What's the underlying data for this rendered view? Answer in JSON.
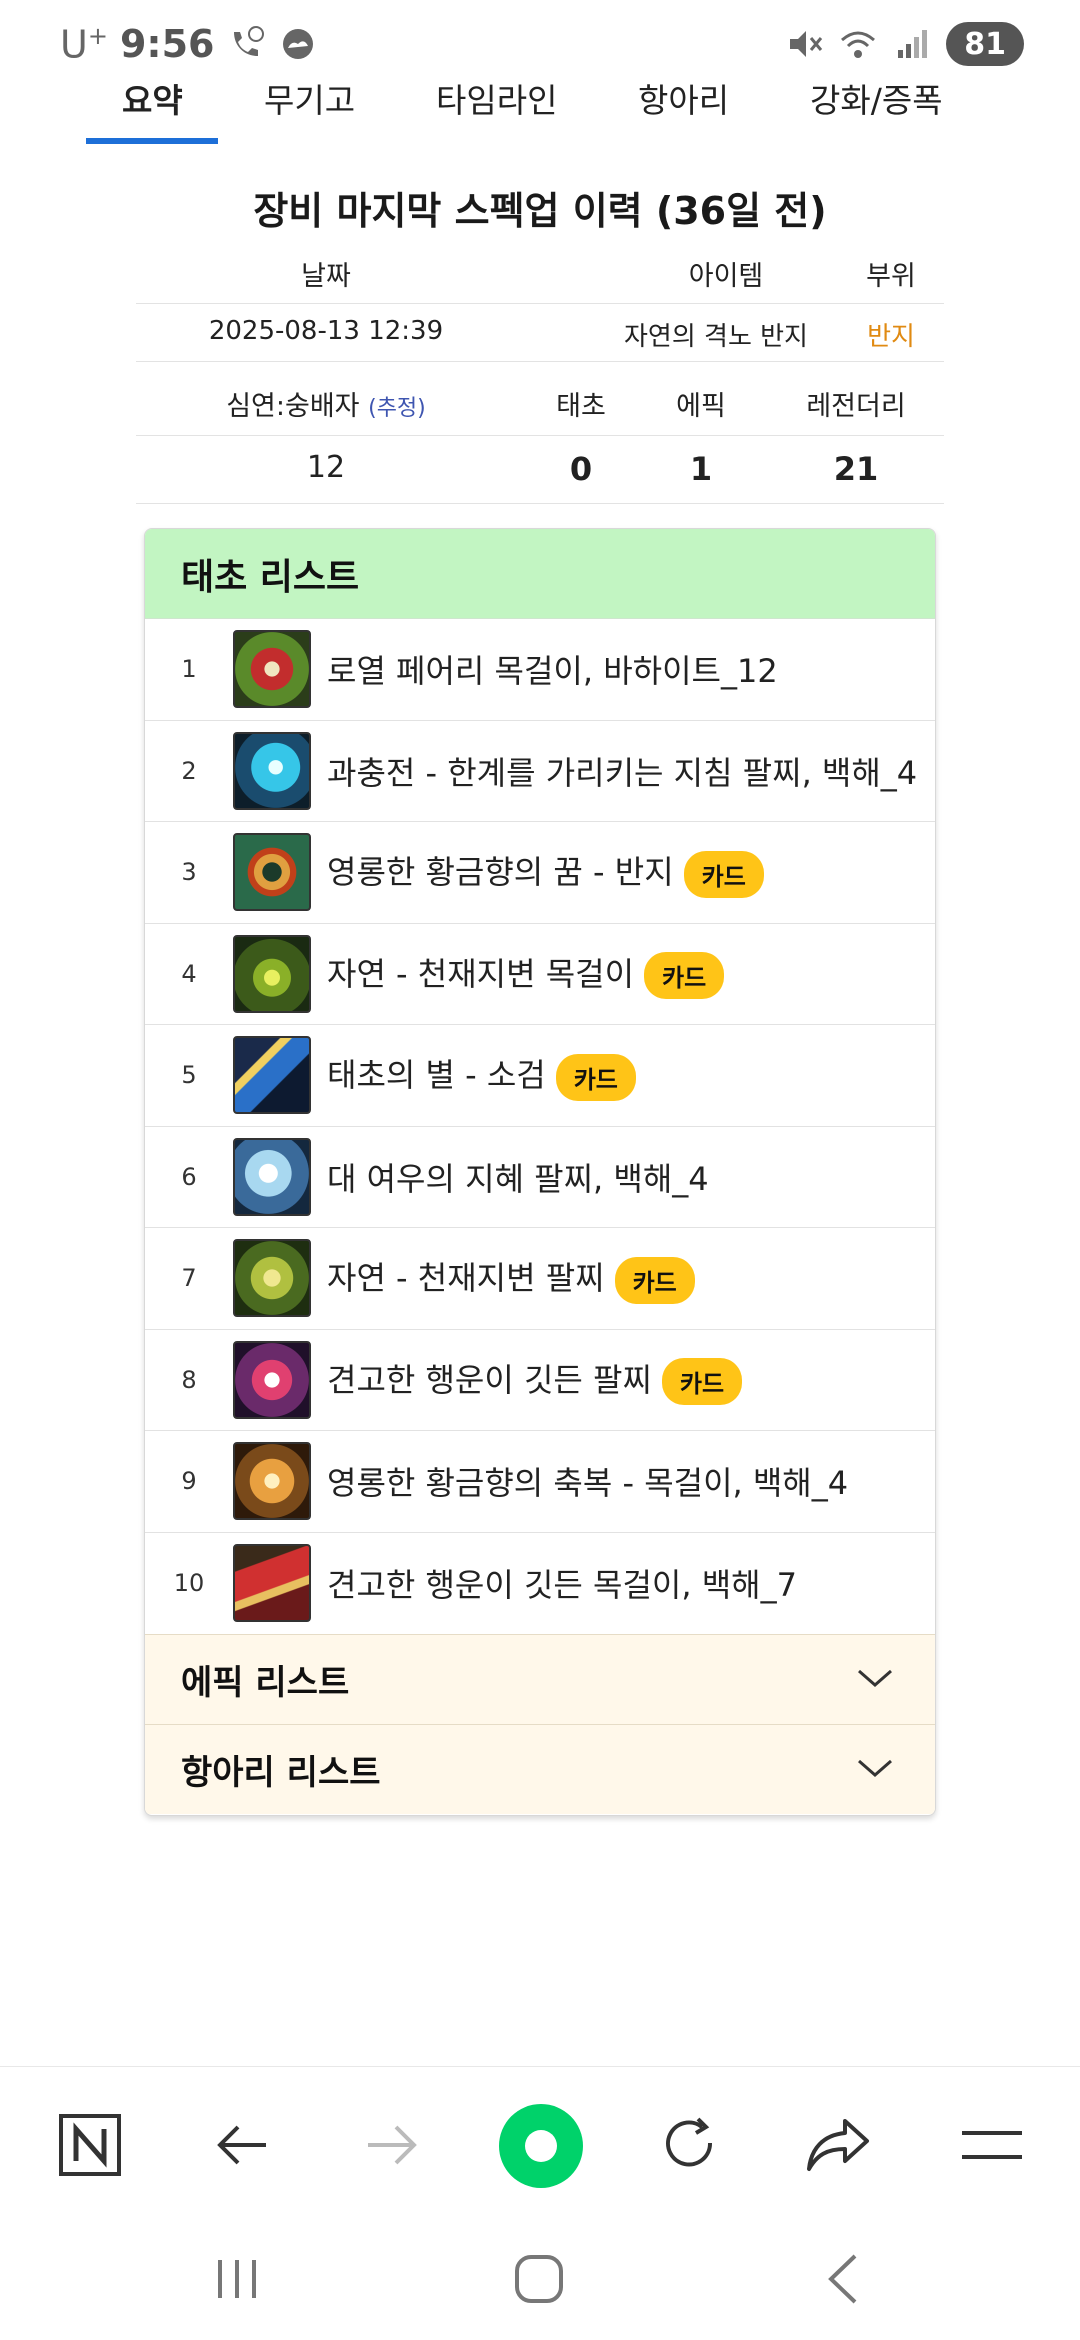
{
  "status": {
    "carrier": "U",
    "carrier_sup": "+",
    "time": "9:56",
    "battery": "81",
    "icons": [
      "phone-who-icon",
      "weather-icon",
      "mute-icon",
      "wifi-icon",
      "signal-icon"
    ]
  },
  "tabs": [
    {
      "label": "요약",
      "active": true
    },
    {
      "label": "무기고",
      "active": false
    },
    {
      "label": "타임라인",
      "active": false
    },
    {
      "label": "항아리",
      "active": false
    },
    {
      "label": "강화/증폭",
      "active": false
    }
  ],
  "summary": {
    "title": "장비 마지막 스펙업 이력 (36일 전)",
    "headers": {
      "date": "날짜",
      "item": "아이템",
      "slot": "부위"
    },
    "row": {
      "date": "2025-08-13 12:39",
      "item": "자연의 격노 반지",
      "slot": "반지"
    },
    "stat_headers": {
      "depth": "심연:숭배자",
      "estimate": "(추정)",
      "primeval": "태초",
      "epic": "에픽",
      "legendary": "레전더리"
    },
    "stat_values": {
      "depth": "12",
      "primeval": "0",
      "epic": "1",
      "legendary": "21"
    }
  },
  "primeval_list": {
    "title": "태초 리스트",
    "badge_label": "카드",
    "items": [
      {
        "index": "1",
        "name": "로열 페어리 목걸이, 바하이트_12",
        "card": false,
        "icon": "flower-necklace-icon"
      },
      {
        "index": "2",
        "name": "과충전 - 한계를 가리키는 지침 팔찌, 백해_4",
        "card": false,
        "icon": "charged-bracelet-icon"
      },
      {
        "index": "3",
        "name": "영롱한 황금향의 꿈 - 반지",
        "card": true,
        "icon": "golden-ring-icon"
      },
      {
        "index": "4",
        "name": "자연 - 천재지변 목걸이",
        "card": true,
        "icon": "nature-necklace-icon"
      },
      {
        "index": "5",
        "name": "태초의 별 - 소검",
        "card": true,
        "icon": "star-sword-icon"
      },
      {
        "index": "6",
        "name": "대 여우의 지혜 팔찌, 백해_4",
        "card": false,
        "icon": "fox-bracelet-icon"
      },
      {
        "index": "7",
        "name": "자연 - 천재지변 팔찌",
        "card": true,
        "icon": "nature-bracelet-icon"
      },
      {
        "index": "8",
        "name": "견고한 행운이 깃든 팔찌",
        "card": true,
        "icon": "luck-bracelet-icon"
      },
      {
        "index": "9",
        "name": "영롱한 황금향의 축복 - 목걸이, 백해_4",
        "card": false,
        "icon": "golden-necklace-icon"
      },
      {
        "index": "10",
        "name": "견고한 행운이 깃든 목걸이, 백해_7",
        "card": false,
        "icon": "luck-necklace-icon"
      }
    ]
  },
  "collapsed_sections": [
    {
      "title": "에픽 리스트"
    },
    {
      "title": "항아리 리스트"
    }
  ],
  "browser_bar": [
    "naver-home-icon",
    "back-arrow-icon",
    "forward-arrow-icon",
    "green-dot-icon",
    "refresh-icon",
    "share-icon",
    "menu-icon"
  ],
  "system_nav": [
    "recent-apps-icon",
    "home-icon",
    "back-icon"
  ],
  "colors": {
    "accent_blue": "#1d6fd8",
    "header_green": "#c2f5c2",
    "collapse_bg": "#fff8ea",
    "badge_yellow": "#ffc417",
    "slot_orange": "#e08a12",
    "green_dot": "#00d26a"
  }
}
